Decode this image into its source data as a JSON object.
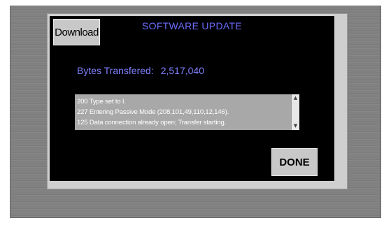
{
  "dialog": {
    "title": "SOFTWARE UPDATE",
    "download_label": "Download",
    "done_label": "DONE",
    "bytes_label": "Bytes Transfered:",
    "bytes_value": "2,517,040"
  },
  "log": {
    "lines": [
      "200 Type set to I.",
      "227 Entering Passive Mode (208,101,49,110,12,146).",
      "125 Data connection already open; Transfer starting."
    ]
  },
  "icons": {
    "scroll_up": "chevron-up-icon",
    "scroll_down": "chevron-down-icon"
  },
  "colors": {
    "screen_bg": "#000000",
    "title_text": "#6c6cff",
    "button_bg": "#c8c8c8",
    "log_bg": "#a8a8a8"
  }
}
